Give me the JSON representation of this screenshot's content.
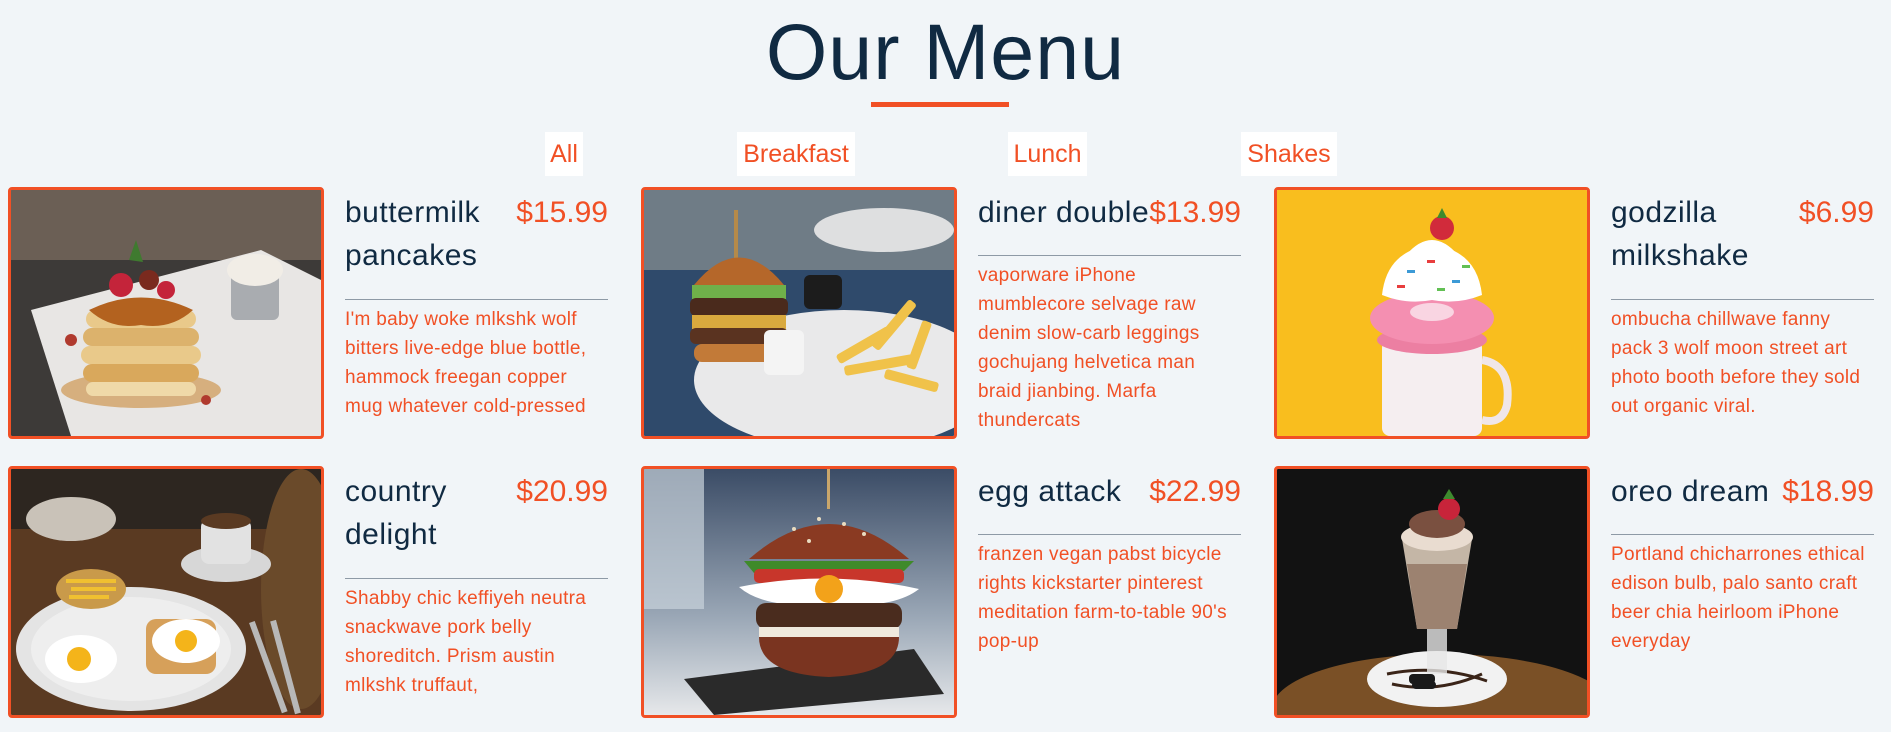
{
  "page": {
    "title": "Our Menu",
    "accent_color": "#f15025",
    "text_color": "#102a42",
    "background_color": "#f1f5f8"
  },
  "filters": [
    {
      "label": "All"
    },
    {
      "label": "Breakfast"
    },
    {
      "label": "Lunch"
    },
    {
      "label": "Shakes"
    }
  ],
  "menu": [
    {
      "name": "buttermilk pancakes",
      "price": "$15.99",
      "desc": "I'm baby woke mlkshk wolf bitters live-edge blue bottle, hammock freegan copper mug whatever cold-pressed",
      "photo_icon": "pancakes-photo"
    },
    {
      "name": "diner double",
      "price": "$13.99",
      "desc": "vaporware iPhone mumblecore selvage raw denim slow-carb leggings gochujang helvetica man braid jianbing. Marfa thundercats",
      "photo_icon": "burger-fries-photo"
    },
    {
      "name": "godzilla milkshake",
      "price": "$6.99",
      "desc": "ombucha chillwave fanny pack 3 wolf moon street art photo booth before they sold out organic viral.",
      "photo_icon": "milkshake-photo"
    },
    {
      "name": "country delight",
      "price": "$20.99",
      "desc": "Shabby chic keffiyeh neutra snackwave pork belly shoreditch. Prism austin mlkshk truffaut,",
      "photo_icon": "breakfast-plate-photo"
    },
    {
      "name": "egg attack",
      "price": "$22.99",
      "desc": "franzen vegan pabst bicycle rights kickstarter pinterest meditation farm-to-table 90's pop-up",
      "photo_icon": "egg-burger-photo"
    },
    {
      "name": "oreo dream",
      "price": "$18.99",
      "desc": "Portland chicharrones ethical edison bulb, palo santo craft beer chia heirloom iPhone everyday",
      "photo_icon": "oreo-shake-photo"
    }
  ]
}
